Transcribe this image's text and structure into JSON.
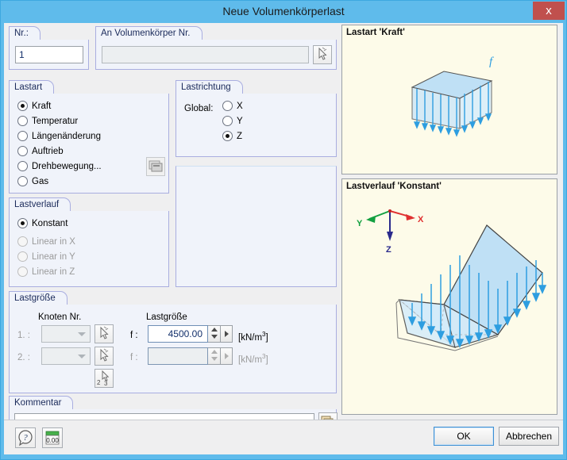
{
  "window": {
    "title": "Neue Volumenkörperlast",
    "close_label": "x",
    "accent_color": "#5fbbeb",
    "close_color": "#c0504d"
  },
  "nr_group": {
    "legend": "Nr.:",
    "value": "1"
  },
  "solid_group": {
    "legend": "An Volumenkörper Nr.",
    "value": "",
    "pick_icon": "pick-cursor-icon"
  },
  "lastart": {
    "legend": "Lastart",
    "selected": "Kraft",
    "options": [
      {
        "label": "Kraft",
        "checked": true,
        "disabled": false
      },
      {
        "label": "Temperatur",
        "checked": false,
        "disabled": false
      },
      {
        "label": "Längenänderung",
        "checked": false,
        "disabled": false
      },
      {
        "label": "Auftrieb",
        "checked": false,
        "disabled": false
      },
      {
        "label": "Drehbewegung...",
        "checked": false,
        "disabled": false
      },
      {
        "label": "Gas",
        "checked": false,
        "disabled": false
      }
    ],
    "settings_icon": "dialog-settings-icon"
  },
  "lastrichtung": {
    "legend": "Lastrichtung",
    "global_label": "Global:",
    "selected": "Z",
    "options": [
      {
        "label": "X",
        "checked": false
      },
      {
        "label": "Y",
        "checked": false
      },
      {
        "label": "Z",
        "checked": true
      }
    ]
  },
  "lastverlauf": {
    "legend": "Lastverlauf",
    "selected": "Konstant",
    "options": [
      {
        "label": "Konstant",
        "checked": true,
        "disabled": false
      },
      {
        "label": "Linear in X",
        "checked": false,
        "disabled": true
      },
      {
        "label": "Linear in Y",
        "checked": false,
        "disabled": true
      },
      {
        "label": "Linear in Z",
        "checked": false,
        "disabled": true
      }
    ]
  },
  "lastgroesse": {
    "legend": "Lastgröße",
    "col_node": "Knoten Nr.",
    "col_value": "Lastgröße",
    "rows": [
      {
        "index_label": "1. :",
        "node_value": "",
        "node_disabled": true,
        "f_label": "f :",
        "value": "4500.00",
        "value_disabled": false,
        "unit": "[kN/m",
        "unit_exp": "3",
        "unit_end": "]"
      },
      {
        "index_label": "2. :",
        "node_value": "",
        "node_disabled": true,
        "f_label": "f :",
        "value": "",
        "value_disabled": true,
        "unit": "[kN/m",
        "unit_exp": "3",
        "unit_end": "]"
      }
    ],
    "pick_icon": "pick-cursor-icon",
    "pick_multi_icon": "pick-cursor-multi-icon",
    "pick_multi_label": "2-3"
  },
  "kommentar": {
    "legend": "Kommentar",
    "value": "",
    "copy_icon": "copy-layers-icon"
  },
  "preview_top": {
    "title": "Lastart 'Kraft'",
    "load_symbol": "f",
    "arrow_color": "#2e9ee0",
    "face_color": "#bfe0f5"
  },
  "preview_bottom": {
    "title": "Lastverlauf 'Konstant'",
    "axes": [
      {
        "label": "X",
        "color": "#e03030"
      },
      {
        "label": "Y",
        "color": "#12a040"
      },
      {
        "label": "Z",
        "color": "#2a2a8c"
      }
    ],
    "arrow_color": "#2e9ee0",
    "face_color": "#bfe0f5"
  },
  "statusbar": {
    "help_icon": "help-question-icon",
    "units_icon": "units-precision-icon",
    "units_label": "0.00",
    "ok_label": "OK",
    "cancel_label": "Abbrechen"
  }
}
